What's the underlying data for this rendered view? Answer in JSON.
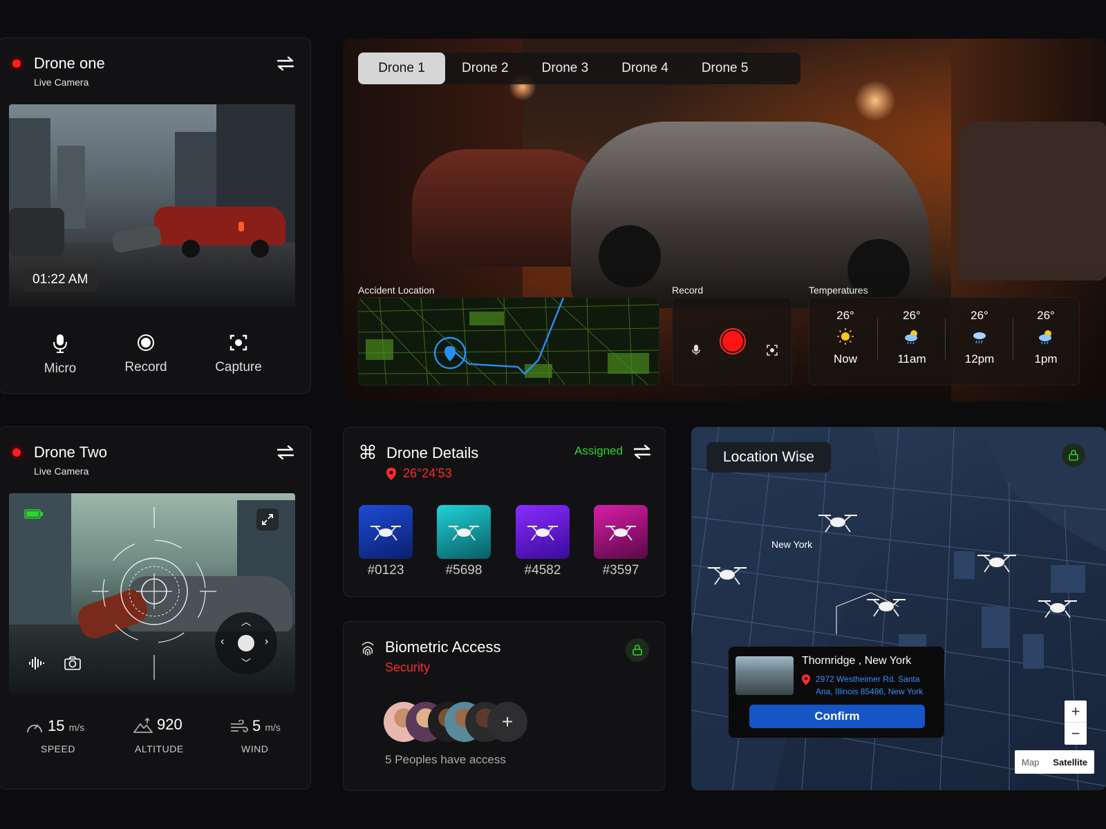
{
  "drone_one": {
    "title": "Drone one",
    "subtitle": "Live Camera",
    "time": "01:22 AM",
    "controls": [
      {
        "label": "Micro",
        "icon": "microphone-icon"
      },
      {
        "label": "Record",
        "icon": "record-icon"
      },
      {
        "label": "Capture",
        "icon": "capture-icon"
      }
    ]
  },
  "main_view": {
    "tabs": [
      "Drone 1",
      "Drone 2",
      "Drone 3",
      "Drone 4",
      "Drone 5"
    ],
    "active_tab": "Drone 1",
    "accident_location_label": "Accident Location",
    "record_label": "Record",
    "temperatures_label": "Temperatures",
    "temperatures": [
      {
        "temp": "26°",
        "time": "Now",
        "icon": "sun-icon"
      },
      {
        "temp": "26°",
        "time": "11am",
        "icon": "cloud-sun-rain-icon"
      },
      {
        "temp": "26°",
        "time": "12pm",
        "icon": "cloud-rain-icon"
      },
      {
        "temp": "26°",
        "time": "1pm",
        "icon": "cloud-sun-rain-icon"
      }
    ]
  },
  "drone_two": {
    "title": "Drone Two",
    "subtitle": "Live Camera",
    "stats": [
      {
        "value": "15",
        "unit": "m/s",
        "label": "SPEED",
        "icon": "speedometer-icon"
      },
      {
        "value": "920",
        "unit": "",
        "label": "ALTITUDE",
        "icon": "mountain-icon"
      },
      {
        "value": "5",
        "unit": "m/s",
        "label": "WIND",
        "icon": "wind-icon"
      }
    ]
  },
  "drone_details": {
    "title": "Drone Details",
    "coordinate": "26°24'53",
    "status": "Assigned",
    "drones": [
      {
        "id": "#0123",
        "color": "#1236a8"
      },
      {
        "id": "#5698",
        "color": "#13a8b0"
      },
      {
        "id": "#4582",
        "color": "#6a1fd8"
      },
      {
        "id": "#3597",
        "color": "#a8157e"
      }
    ]
  },
  "biometric": {
    "title": "Biometric Access",
    "subtitle": "Security",
    "access_text": "5 Peoples have access"
  },
  "location_map": {
    "title": "Location Wise",
    "city_label": "New York",
    "place_name": "Thornridge , New York",
    "address": "2972 Westheimer Rd. Santa Ana, Illinois 85486, New York",
    "confirm_label": "Confirm",
    "zoom_in": "+",
    "zoom_out": "−",
    "map_types": [
      "Map",
      "Satellite"
    ],
    "selected_map_type": "Satellite"
  },
  "colors": {
    "live": "#ff1e1e",
    "assigned": "#2bd62b",
    "security": "#ff2a2a",
    "address": "#3a8bff",
    "confirm": "#1555c6"
  }
}
